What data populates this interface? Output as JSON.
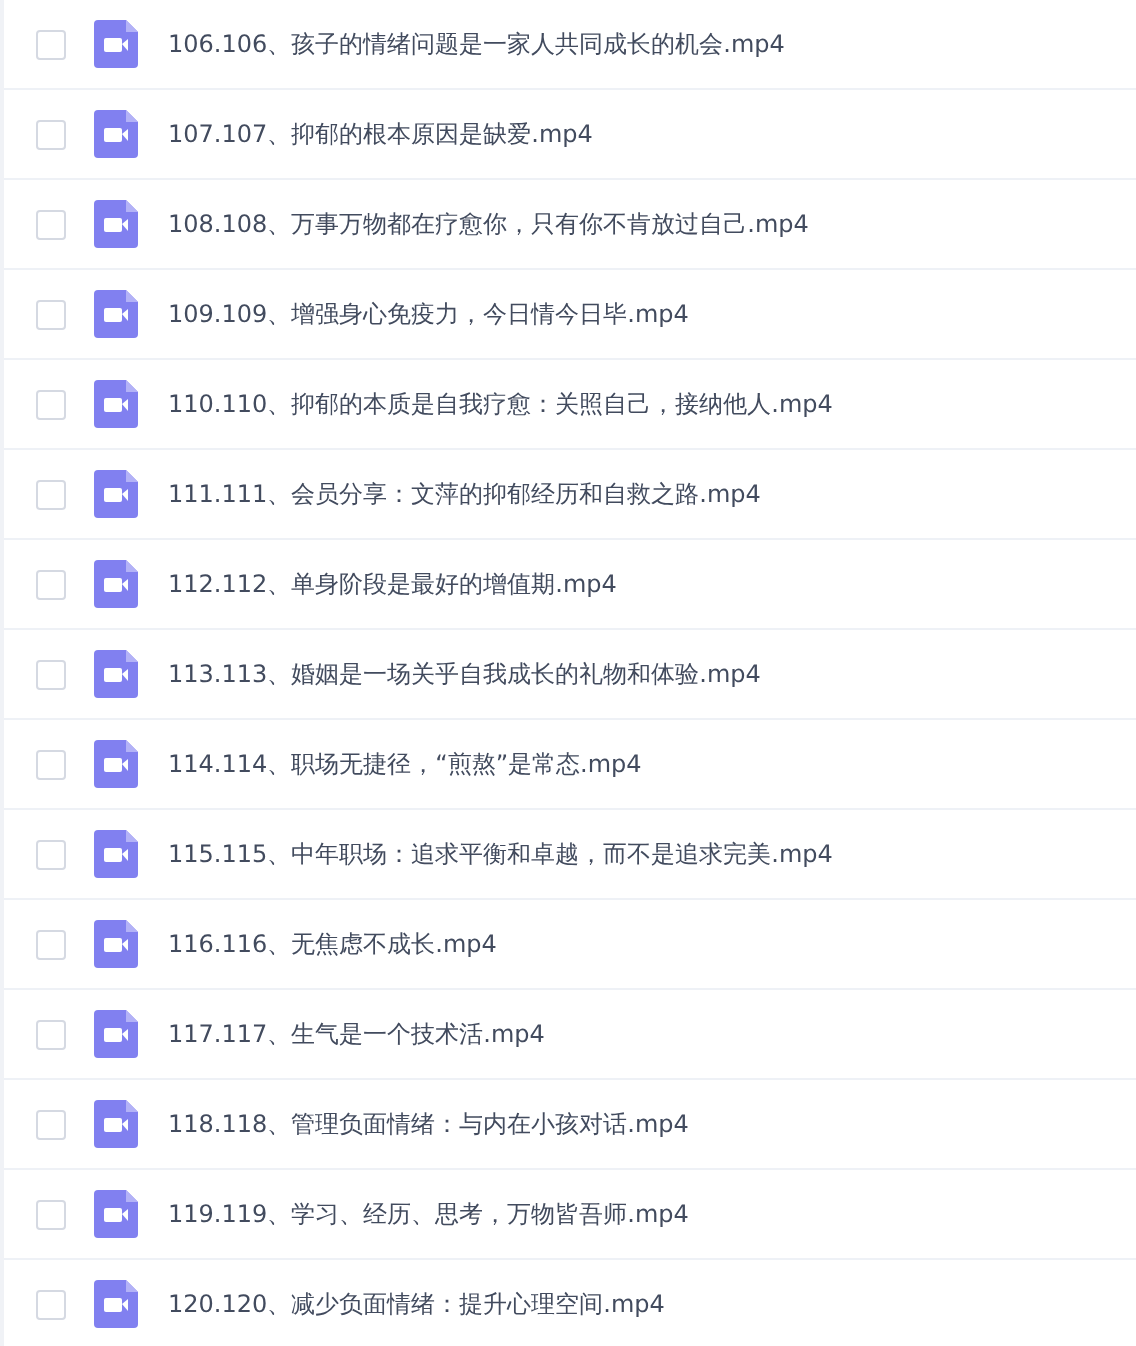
{
  "files": [
    {
      "name": "106.106、孩子的情绪问题是一家人共同成长的机会.mp4",
      "checked": false
    },
    {
      "name": "107.107、抑郁的根本原因是缺爱.mp4",
      "checked": false
    },
    {
      "name": "108.108、万事万物都在疗愈你，只有你不肯放过自己.mp4",
      "checked": false
    },
    {
      "name": "109.109、增强身心免疫力，今日情今日毕.mp4",
      "checked": false
    },
    {
      "name": "110.110、抑郁的本质是自我疗愈：关照自己，接纳他人.mp4",
      "checked": false
    },
    {
      "name": "111.111、会员分享：文萍的抑郁经历和自救之路.mp4",
      "checked": false
    },
    {
      "name": "112.112、单身阶段是最好的增值期.mp4",
      "checked": false
    },
    {
      "name": "113.113、婚姻是一场关乎自我成长的礼物和体验.mp4",
      "checked": false
    },
    {
      "name": "114.114、职场无捷径，“煎熬”是常态.mp4",
      "checked": false
    },
    {
      "name": "115.115、中年职场：追求平衡和卓越，而不是追求完美.mp4",
      "checked": false
    },
    {
      "name": "116.116、无焦虑不成长.mp4",
      "checked": false
    },
    {
      "name": "117.117、生气是一个技术活.mp4",
      "checked": false
    },
    {
      "name": "118.118、管理负面情绪：与内在小孩对话.mp4",
      "checked": false
    },
    {
      "name": "119.119、学习、经历、思考，万物皆吾师.mp4",
      "checked": false
    },
    {
      "name": "120.120、减少负面情绪：提升心理空间.mp4",
      "checked": false
    }
  ]
}
